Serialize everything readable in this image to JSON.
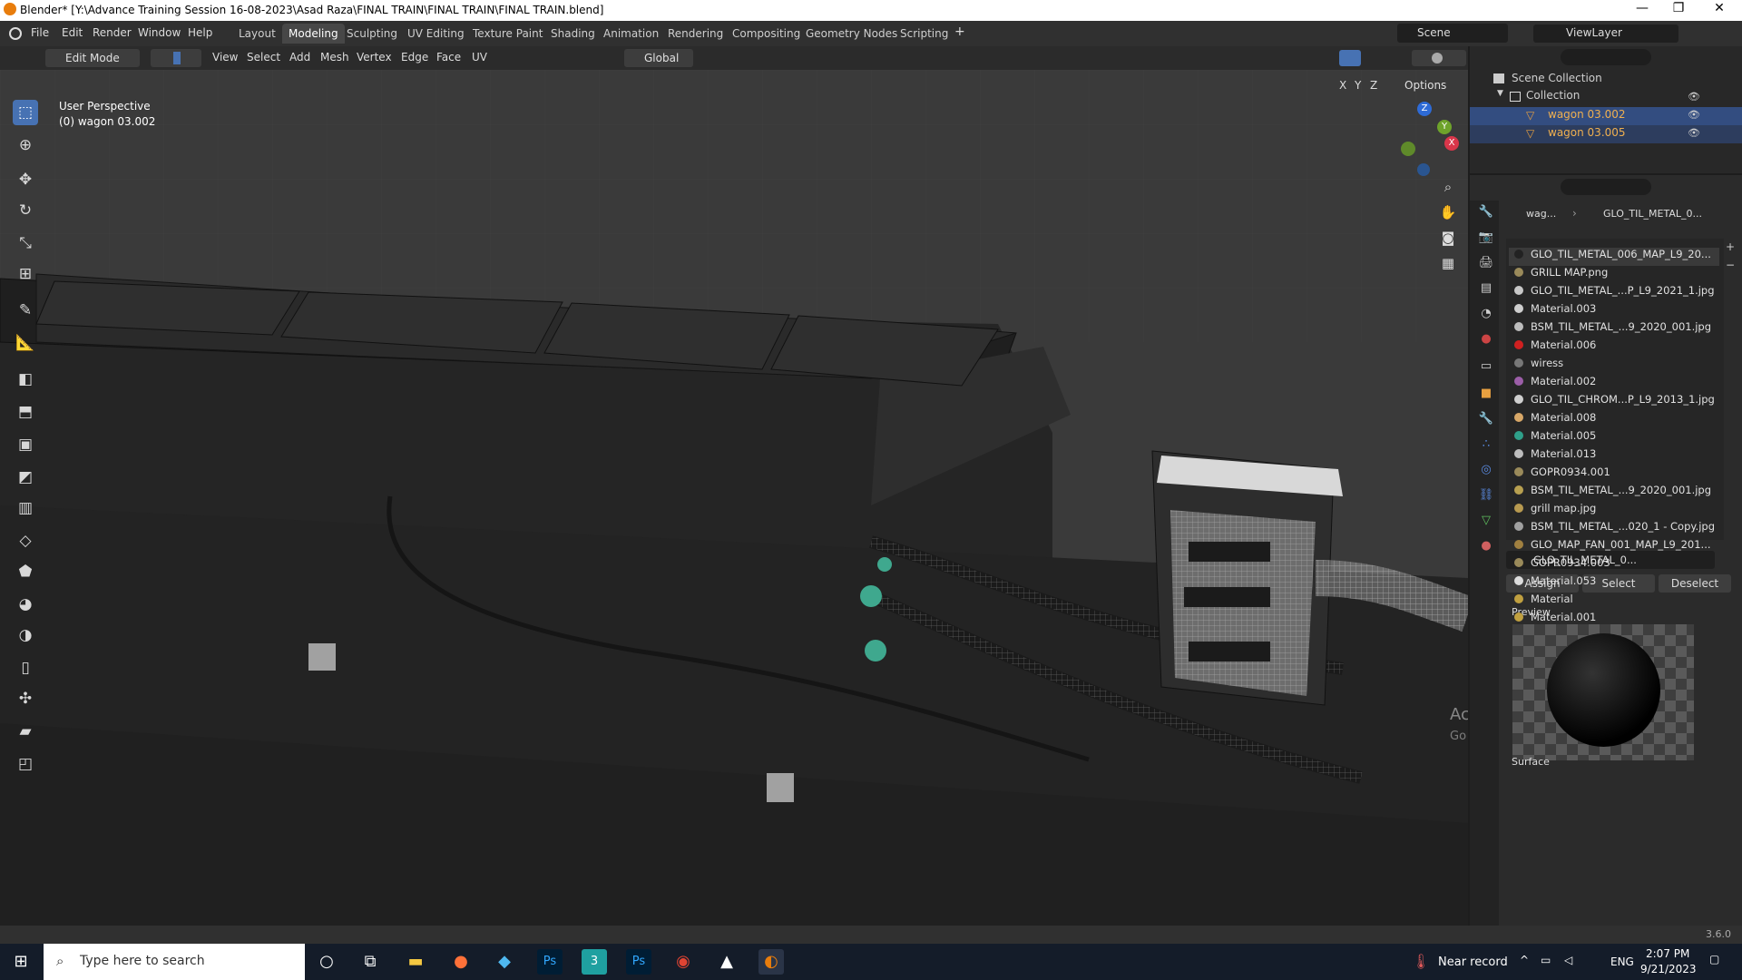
{
  "window": {
    "title": "Blender* [Y:\\Advance Training Session 16-08-2023\\Asad Raza\\FINAL TRAIN\\FINAL TRAIN\\FINAL TRAIN.blend]",
    "minimize": "—",
    "maximize": "❐",
    "close": "✕"
  },
  "menu": [
    "File",
    "Edit",
    "Render",
    "Window",
    "Help"
  ],
  "workspaces": [
    "Layout",
    "Modeling",
    "Sculpting",
    "UV Editing",
    "Texture Paint",
    "Shading",
    "Animation",
    "Rendering",
    "Compositing",
    "Geometry Nodes",
    "Scripting"
  ],
  "active_workspace": "Modeling",
  "scene": "Scene",
  "view_layer": "ViewLayer",
  "viewport_header": {
    "mode": "Edit Mode",
    "menus": [
      "View",
      "Select",
      "Add",
      "Mesh",
      "Vertex",
      "Edge",
      "Face",
      "UV"
    ],
    "transform_orientation": "Global",
    "axes": [
      "X",
      "Y",
      "Z"
    ],
    "options": "Options"
  },
  "viewport": {
    "view_name": "User Perspective",
    "object_info": "(0) wagon 03.002",
    "watermark_title": "Activate Windows",
    "watermark_sub": "Go to Settings to activate Windows.",
    "gizmo": {
      "x": "X",
      "y": "Y",
      "z": "Z"
    }
  },
  "outliner": {
    "scene_collection": "Scene Collection",
    "collection": "Collection",
    "objects": [
      "wagon 03.002",
      "wagon 03.005"
    ]
  },
  "properties": {
    "breadcrumb_object": "wag...",
    "breadcrumb_material": "GLO_TIL_METAL_0...",
    "materials": [
      {
        "name": "GLO_TIL_METAL_006_MAP_L9_20...",
        "color": "#222222"
      },
      {
        "name": "GRILL MAP.png",
        "color": "#9a8a5a"
      },
      {
        "name": "GLO_TIL_METAL_...P_L9_2021_1.jpg",
        "color": "#c8c8c8"
      },
      {
        "name": "Material.003",
        "color": "#cfcfcf"
      },
      {
        "name": "BSM_TIL_METAL_...9_2020_001.jpg",
        "color": "#bdbdbd"
      },
      {
        "name": "Material.006",
        "color": "#d02020"
      },
      {
        "name": "wiress",
        "color": "#777777"
      },
      {
        "name": "Material.002",
        "color": "#9c5ea8"
      },
      {
        "name": "GLO_TIL_CHROM...P_L9_2013_1.jpg",
        "color": "#cfcfcf"
      },
      {
        "name": "Material.008",
        "color": "#d8a868"
      },
      {
        "name": "Material.005",
        "color": "#2fa08a"
      },
      {
        "name": "Material.013",
        "color": "#bdbdbd"
      },
      {
        "name": "GOPR0934.001",
        "color": "#9a8a5a"
      },
      {
        "name": "BSM_TIL_METAL_...9_2020_001.jpg",
        "color": "#b8a050"
      },
      {
        "name": "grill map.jpg",
        "color": "#b89a50"
      },
      {
        "name": "BSM_TIL_METAL_...020_1 - Copy.jpg",
        "color": "#a0a0a0"
      },
      {
        "name": "GLO_MAP_FAN_001_MAP_L9_201...",
        "color": "#a08040"
      },
      {
        "name": "GOPR0934.003",
        "color": "#9a8a5a"
      },
      {
        "name": "Material.053",
        "color": "#dddddd"
      },
      {
        "name": "Material",
        "color": "#c0a040"
      },
      {
        "name": "Material.001",
        "color": "#c0a040"
      }
    ],
    "slot_material": "GLO_TIL_METAL_0...",
    "assign": "Assign",
    "select": "Select",
    "deselect": "Deselect",
    "preview": "Preview",
    "surface": "Surface"
  },
  "status": {
    "version": "3.6.0"
  },
  "taskbar": {
    "search_placeholder": "Type here to search",
    "weather": "Near record",
    "language": "ENG",
    "time": "2:07 PM",
    "date": "9/21/2023"
  }
}
